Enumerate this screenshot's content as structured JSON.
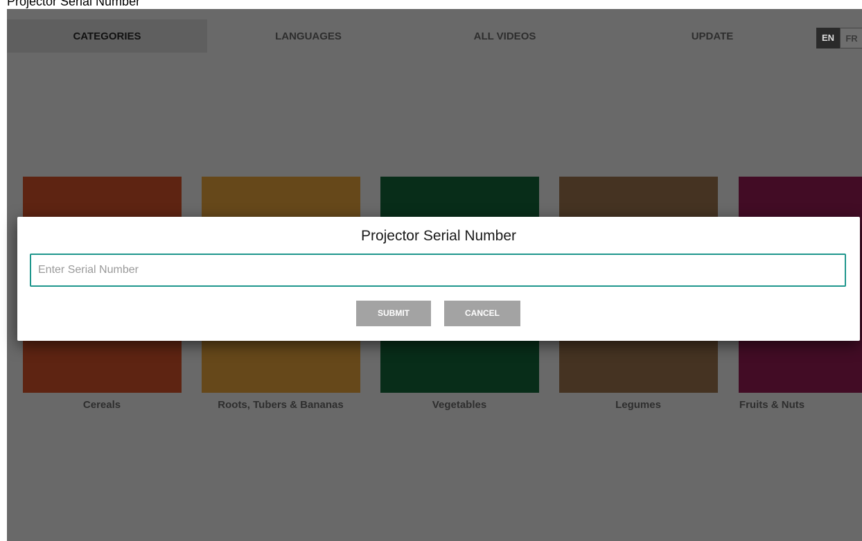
{
  "window": {
    "title": "Projector Serial Number"
  },
  "nav": {
    "tabs": [
      {
        "label": "CATEGORIES",
        "active": true
      },
      {
        "label": "LANGUAGES",
        "active": false
      },
      {
        "label": "ALL VIDEOS",
        "active": false
      },
      {
        "label": "UPDATE",
        "active": false
      }
    ],
    "languages": [
      {
        "code": "EN",
        "selected": true
      },
      {
        "code": "FR",
        "selected": false
      }
    ]
  },
  "categories": [
    {
      "label": "Cereals",
      "color": "#5e2412"
    },
    {
      "label": "Roots, Tubers & Bananas",
      "color": "#66481a"
    },
    {
      "label": "Vegetables",
      "color": "#082d19"
    },
    {
      "label": "Legumes",
      "color": "#453322"
    },
    {
      "label": "Fruits & Nuts",
      "color": "#420c25"
    }
  ],
  "dialog": {
    "title": "Projector Serial Number",
    "input_placeholder": "Enter Serial Number",
    "input_value": "",
    "submit_label": "SUBMIT",
    "cancel_label": "CANCEL"
  },
  "colors": {
    "overlay": "#696969",
    "input_border": "#1e968c",
    "button_bg": "#a3a3a3"
  }
}
